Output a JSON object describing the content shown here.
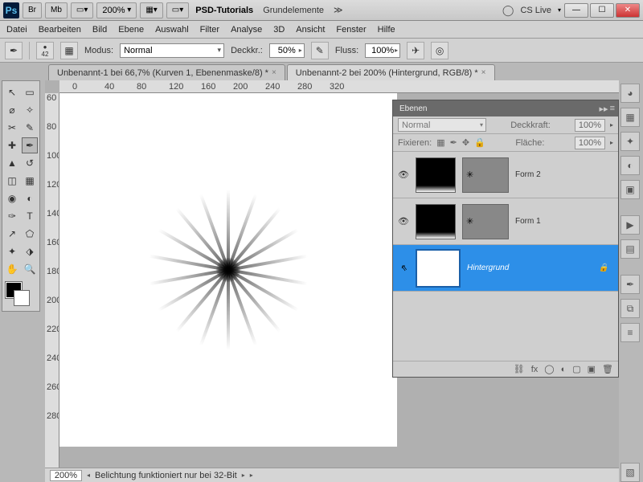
{
  "app": {
    "icon": "Ps",
    "cslive": "CS Live"
  },
  "title_buttons": {
    "br": "Br",
    "mb": "Mb",
    "zoom": "200%",
    "tutorials": "PSD-Tutorials",
    "grund": "Grundelemente"
  },
  "menu": [
    "Datei",
    "Bearbeiten",
    "Bild",
    "Ebene",
    "Auswahl",
    "Filter",
    "Analyse",
    "3D",
    "Ansicht",
    "Fenster",
    "Hilfe"
  ],
  "options": {
    "brush_size": "42",
    "modus_label": "Modus:",
    "modus_value": "Normal",
    "deck_label": "Deckkr.:",
    "deck_value": "50%",
    "fluss_label": "Fluss:",
    "fluss_value": "100%"
  },
  "tabs": {
    "t1": "Unbenannt-1 bei 66,7% (Kurven 1, Ebenenmaske/8) *",
    "t2": "Unbenannt-2 bei 200% (Hintergrund, RGB/8) *"
  },
  "ruler_h": [
    "0",
    "40",
    "80",
    "120",
    "160",
    "200",
    "240",
    "280",
    "320"
  ],
  "ruler_v": [
    "60",
    "80",
    "100",
    "120",
    "140",
    "160",
    "180",
    "200",
    "220",
    "240",
    "260",
    "280"
  ],
  "panel": {
    "title": "Ebenen",
    "blend": "Normal",
    "deck_label": "Deckkraft:",
    "deck_value": "100%",
    "fix_label": "Fixieren:",
    "flaeche_label": "Fläche:",
    "flaeche_value": "100%",
    "layers": [
      {
        "name": "Form 2",
        "mask_sym": "✳"
      },
      {
        "name": "Form 1",
        "mask_sym": "✳"
      },
      {
        "name": "Hintergrund"
      }
    ],
    "footer_fx": "fx"
  },
  "status": {
    "zoom": "200%",
    "msg": "Belichtung funktioniert nur bei 32-Bit"
  }
}
